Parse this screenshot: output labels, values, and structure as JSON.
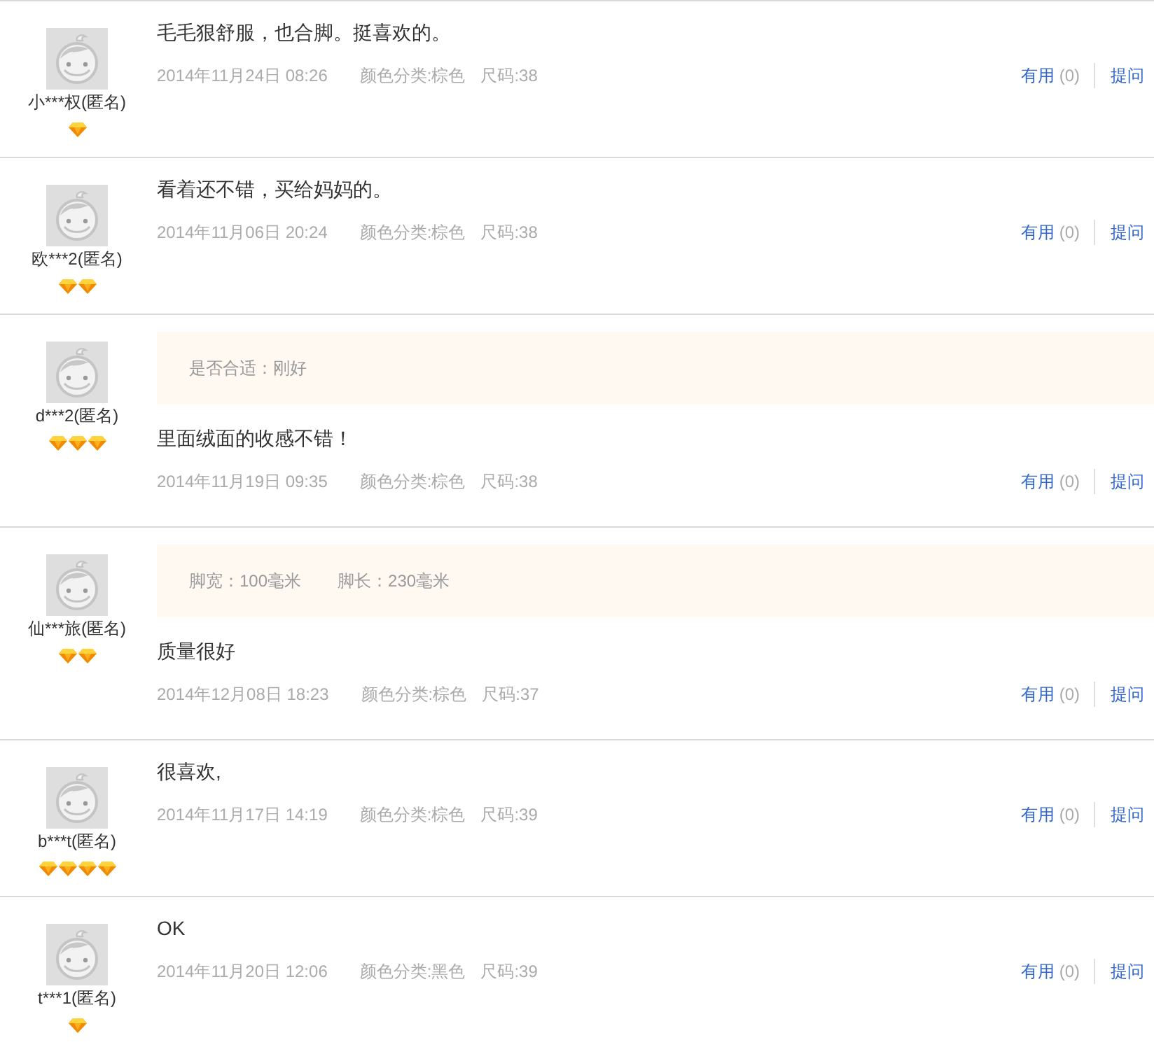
{
  "reviews": [
    {
      "user": "小***权(匿名)",
      "rank_icons": [
        {
          "kind": "diamond"
        }
      ],
      "comment": "毛毛狠舒服，也合脚。挺喜欢的。",
      "date": "2014年11月24日 08:26",
      "attributes": [
        "颜色分类:棕色",
        "尺码:38"
      ],
      "useful": {
        "label": "有用",
        "count": "(0)"
      },
      "ask": "提问"
    },
    {
      "user": "欧***2(匿名)",
      "rank_icons": [
        {
          "kind": "diamond"
        },
        {
          "kind": "diamond"
        }
      ],
      "comment": "看着还不错，买给妈妈的。",
      "date": "2014年11月06日 20:24",
      "attributes": [
        "颜色分类:棕色",
        "尺码:38"
      ],
      "useful": {
        "label": "有用",
        "count": "(0)"
      },
      "ask": "提问"
    },
    {
      "user": "d***2(匿名)",
      "rank_icons": [
        {
          "kind": "diamond"
        },
        {
          "kind": "diamond"
        },
        {
          "kind": "diamond"
        }
      ],
      "fit_info": [
        "是否合适：刚好"
      ],
      "comment": "里面绒面的收感不错！",
      "date": "2014年11月19日 09:35",
      "attributes": [
        "颜色分类:棕色",
        "尺码:38"
      ],
      "useful": {
        "label": "有用",
        "count": "(0)"
      },
      "ask": "提问"
    },
    {
      "user": "仙***旅(匿名)",
      "rank_icons": [
        {
          "kind": "diamond"
        },
        {
          "kind": "diamond"
        }
      ],
      "fit_info": [
        "脚宽：100毫米",
        "脚长：230毫米"
      ],
      "comment": "质量很好",
      "date": "2014年12月08日 18:23",
      "attributes": [
        "颜色分类:棕色",
        "尺码:37"
      ],
      "useful": {
        "label": "有用",
        "count": "(0)"
      },
      "ask": "提问"
    },
    {
      "user": "b***t(匿名)",
      "rank_icons": [
        {
          "kind": "diamond"
        },
        {
          "kind": "diamond"
        },
        {
          "kind": "diamond"
        },
        {
          "kind": "diamond"
        }
      ],
      "comment": "很喜欢,",
      "date": "2014年11月17日 14:19",
      "attributes": [
        "颜色分类:棕色",
        "尺码:39"
      ],
      "useful": {
        "label": "有用",
        "count": "(0)"
      },
      "ask": "提问"
    },
    {
      "user": "t***1(匿名)",
      "rank_icons": [
        {
          "kind": "diamond"
        }
      ],
      "comment": "OK",
      "date": "2014年11月20日 12:06",
      "attributes": [
        "颜色分类:黑色",
        "尺码:39"
      ],
      "useful": {
        "label": "有用",
        "count": "(0)"
      },
      "ask": "提问"
    }
  ]
}
